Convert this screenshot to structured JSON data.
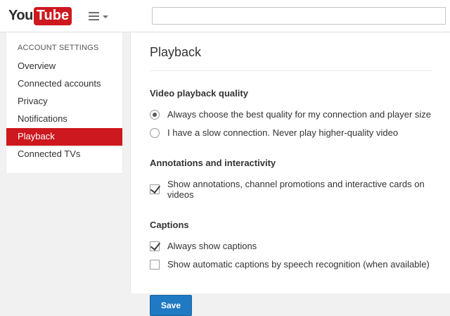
{
  "header": {
    "logo": {
      "you": "You",
      "tube": "Tube"
    },
    "search": {
      "value": ""
    }
  },
  "sidebar": {
    "title": "ACCOUNT SETTINGS",
    "items": [
      {
        "label": "Overview",
        "active": false
      },
      {
        "label": "Connected accounts",
        "active": false
      },
      {
        "label": "Privacy",
        "active": false
      },
      {
        "label": "Notifications",
        "active": false
      },
      {
        "label": "Playback",
        "active": true
      },
      {
        "label": "Connected TVs",
        "active": false
      }
    ]
  },
  "main": {
    "title": "Playback",
    "sections": [
      {
        "heading": "Video playback quality",
        "options": [
          {
            "type": "radio",
            "checked": true,
            "label": "Always choose the best quality for my connection and player size"
          },
          {
            "type": "radio",
            "checked": false,
            "label": "I have a slow connection. Never play higher-quality video"
          }
        ]
      },
      {
        "heading": "Annotations and interactivity",
        "options": [
          {
            "type": "checkbox",
            "checked": true,
            "label": "Show annotations, channel promotions and interactive cards on videos"
          }
        ]
      },
      {
        "heading": "Captions",
        "options": [
          {
            "type": "checkbox",
            "checked": true,
            "label": "Always show captions"
          },
          {
            "type": "checkbox",
            "checked": false,
            "label": "Show automatic captions by speech recognition (when available)"
          }
        ]
      }
    ],
    "save_label": "Save"
  },
  "colors": {
    "accent_red": "#cc181e",
    "save_blue": "#2079c3"
  }
}
